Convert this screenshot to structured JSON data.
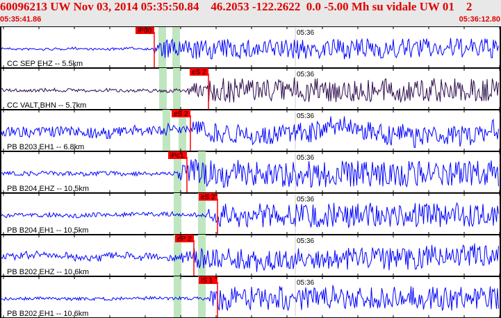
{
  "header": {
    "title": "60096213 UW Nov 03, 2014 05:35:50.84    46.2053 -122.2622  0.0 -5.00 Mh su vidale UW 01    2",
    "start_time": "05:35:41.86",
    "end_time": "05:36:12.80"
  },
  "time_tick_label": "05:36",
  "colors": {
    "trace": "#0000ff",
    "trace_alt": "#2a0a4a",
    "pick": "#ff0000",
    "window": "#bfe6bf",
    "header_text": "#e00000"
  },
  "traces": [
    {
      "label": "CC SEP EHZ -- 5.5km",
      "pick": "iPd0",
      "color": "#0000ff"
    },
    {
      "label": "CC VALT BHN -- 5.7km",
      "pick": "eS 2",
      "color": "#2a0a4a"
    },
    {
      "label": "PB B203 EH1 -- 6.8km",
      "pick": "eS 2",
      "color": "#0000ff"
    },
    {
      "label": "PB B204 EHZ -- 10.5km",
      "pick": "iPc1",
      "color": "#0000ff"
    },
    {
      "label": "PB B204 EH1 -- 10.5km",
      "pick": "eS 2",
      "color": "#0000ff"
    },
    {
      "label": "PB B202 EHZ -- 10.6km",
      "pick": "eP 2",
      "color": "#0000ff"
    },
    {
      "label": "PB B202 EH1 -- 10.6km",
      "pick": "iS 1",
      "color": "#0000ff"
    }
  ]
}
